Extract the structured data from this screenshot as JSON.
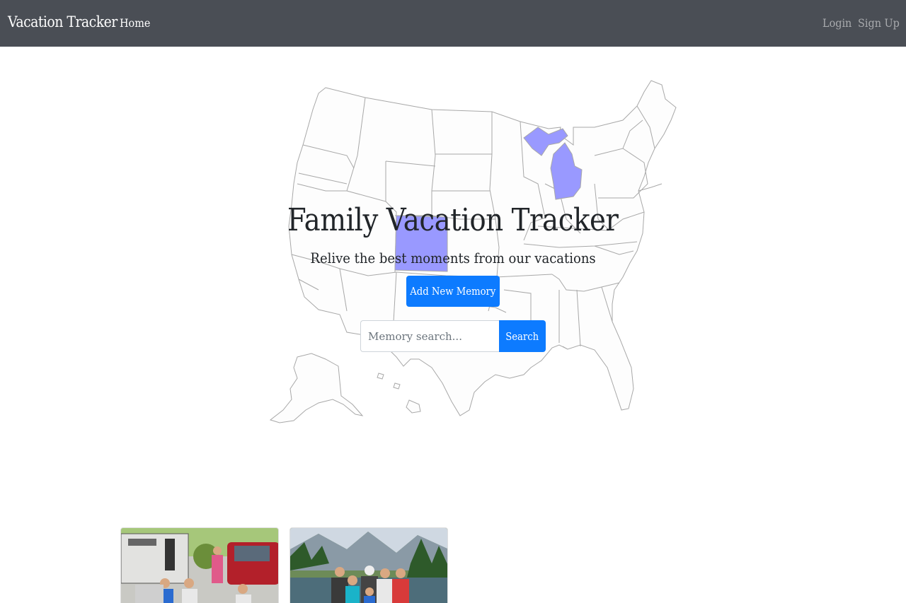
{
  "navbar": {
    "brand": "Vacation Tracker",
    "home": "Home",
    "login": "Login",
    "signup": "Sign Up"
  },
  "hero": {
    "title": "Family Vacation Tracker",
    "subtitle": "Relive the best moments from our vacations",
    "add_button": "Add New Memory",
    "highlighted_states": [
      "Michigan",
      "Colorado"
    ],
    "highlight_color": "#9999ff"
  },
  "search": {
    "placeholder": "Memory search...",
    "button": "Search"
  },
  "colors": {
    "navbar": "#4a4e55",
    "primary": "#0d7bff"
  }
}
